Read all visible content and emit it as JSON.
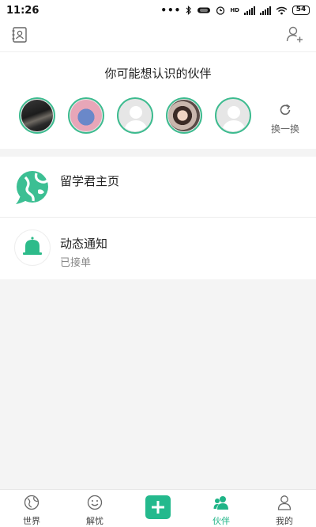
{
  "status_bar": {
    "time": "11:26",
    "dots": "•••",
    "network": "HD",
    "battery": "54"
  },
  "topbar": {
    "contacts_icon": "contacts-card-icon",
    "add_friend_icon": "add-user-icon"
  },
  "friends": {
    "title": "你可能想认识的伙伴",
    "refresh_label": "换一换",
    "avatars": [
      "photo-dark",
      "cartoon-blue",
      "placeholder",
      "photo-girl",
      "placeholder"
    ]
  },
  "list": {
    "items": [
      {
        "title": "留学君主页",
        "icon": "globe-chat-icon"
      },
      {
        "title": "动态通知",
        "subtitle": "已接单",
        "icon": "bell-icon"
      }
    ]
  },
  "tabs": [
    {
      "label": "世界",
      "icon": "globe-icon",
      "active": false
    },
    {
      "label": "解忧",
      "icon": "smile-icon",
      "active": false
    },
    {
      "label": "",
      "icon": "plus-icon",
      "active": false
    },
    {
      "label": "伙伴",
      "icon": "friends-icon",
      "active": true
    },
    {
      "label": "我的",
      "icon": "profile-icon",
      "active": false
    }
  ],
  "colors": {
    "accent": "#24b98d",
    "active_tab": "#1fb487"
  }
}
